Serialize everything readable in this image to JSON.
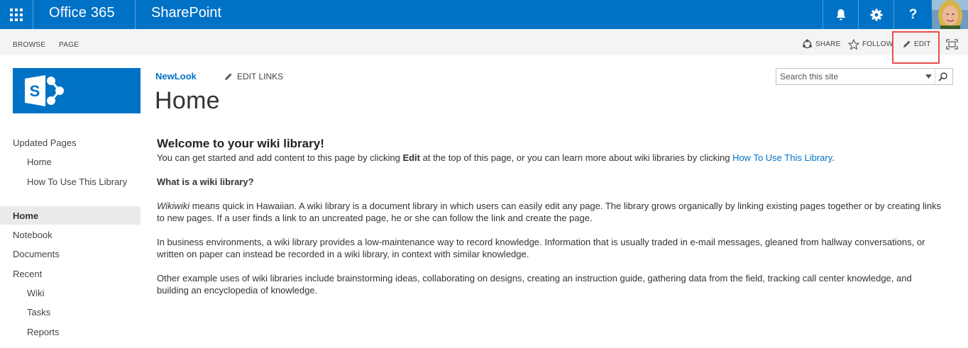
{
  "suitebar": {
    "brand": "Office 365",
    "app": "SharePoint",
    "icons": [
      "waffle-icon",
      "bell-icon",
      "gear-icon",
      "help-icon"
    ],
    "help_label": "?"
  },
  "ribbon": {
    "tabs": [
      "BROWSE",
      "PAGE"
    ],
    "actions": {
      "share": "SHARE",
      "follow": "FOLLOW",
      "edit": "EDIT"
    }
  },
  "header": {
    "site_link": "NewLook",
    "edit_links": "EDIT LINKS",
    "page_title": "Home"
  },
  "search": {
    "placeholder": "Search this site"
  },
  "nav": {
    "items": [
      {
        "label": "Updated Pages",
        "level": 1
      },
      {
        "label": "Home",
        "level": 2
      },
      {
        "label": "How To Use This Library",
        "level": 2
      },
      {
        "label": "Home",
        "level": 1,
        "selected": true
      },
      {
        "label": "Notebook",
        "level": 1
      },
      {
        "label": "Documents",
        "level": 1
      },
      {
        "label": "Recent",
        "level": 1
      },
      {
        "label": "Wiki",
        "level": 2
      },
      {
        "label": "Tasks",
        "level": 2
      },
      {
        "label": "Reports",
        "level": 2
      }
    ]
  },
  "content": {
    "heading": "Welcome to your wiki library!",
    "intro_before": "You can get started and add content to this page by clicking ",
    "intro_bold": "Edit",
    "intro_middle": " at the top of this page, or you can learn more about wiki libraries by clicking ",
    "intro_link": "How To Use This Library",
    "intro_after": ".",
    "question": "What is a wiki library?",
    "para1_italic": "Wikiwiki",
    "para1_rest": " means quick in Hawaiian. A wiki library is a document library in which users can easily edit any page. The library grows organically by linking existing pages together or by creating links to new pages. If a user finds a link to an uncreated page, he or she can follow the link and create the page.",
    "para2": "In business environments, a wiki library provides a low-maintenance way to record knowledge. Information that is usually traded in e-mail messages, gleaned from hallway conversations, or written on paper can instead be recorded in a wiki library, in context with similar knowledge.",
    "para3": "Other example uses of wiki libraries include brainstorming ideas, collaborating on designs, creating an instruction guide, gathering data from the field, tracking call center knowledge, and building an encyclopedia of knowledge."
  },
  "colors": {
    "suitebar": "#0072c6",
    "link": "#0072c6",
    "highlight": "#e84c4c",
    "ribbon": "#f4f4f4"
  }
}
